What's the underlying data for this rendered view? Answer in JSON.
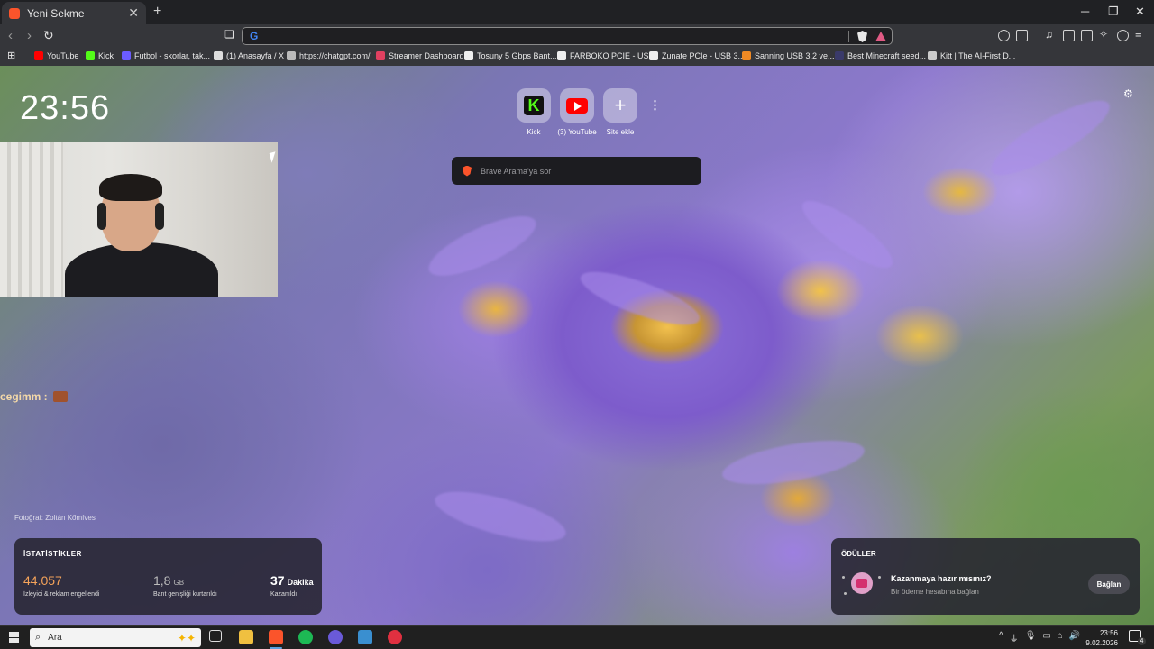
{
  "tab": {
    "title": "Yeni Sekme"
  },
  "omnibox": {
    "value": ""
  },
  "bookmarks": [
    {
      "label": "YouTube",
      "color": "#ff0000"
    },
    {
      "label": "Kick",
      "color": "#53fc18"
    },
    {
      "label": "Futbol - skorlar, tak...",
      "color": "#6b5cff"
    },
    {
      "label": "(1) Anasayfa / X",
      "color": "#dddddd"
    },
    {
      "label": "https://chatgpt.com/",
      "color": "#bbbbbb"
    },
    {
      "label": "Streamer Dashboard",
      "color": "#e04060"
    },
    {
      "label": "Tosuny 5 Gbps Bant...",
      "color": "#eeeeee"
    },
    {
      "label": "FARBOKO PCIE - US...",
      "color": "#eeeeee"
    },
    {
      "label": "Zunate PCIe - USB 3...",
      "color": "#eeeeee"
    },
    {
      "label": "Sanning USB 3.2 ve...",
      "color": "#f08a24"
    },
    {
      "label": "Best Minecraft seed...",
      "color": "#3a3a6a"
    },
    {
      "label": "Kitt | The AI-First D...",
      "color": "#cccccc"
    }
  ],
  "clock": "23:56",
  "chat": {
    "text": "cegimm :"
  },
  "photo_credit": "Fotoğraf: Zoltán Kőmíves",
  "top_sites": [
    {
      "label": "Kick"
    },
    {
      "label": "(3) YouTube"
    },
    {
      "label": "Site ekle"
    }
  ],
  "search": {
    "placeholder": "Brave Arama'ya sor"
  },
  "stats": {
    "title": "İSTATİSTİKLER",
    "blocked_value": "44.057",
    "blocked_desc": "İzleyici & reklam engellendi",
    "bandwidth_value": "1,8",
    "bandwidth_unit": "GB",
    "bandwidth_desc": "Bant genişliği kurtarıldı",
    "time_value": "37",
    "time_unit": "Dakika",
    "time_desc": "Kazanıldı",
    "accent": "#f5a35a"
  },
  "rewards": {
    "title": "ÖDÜLLER",
    "headline": "Kazanmaya hazır mısınız?",
    "subtext": "Bir ödeme hesabına bağlan",
    "button": "Bağlan"
  },
  "taskbar": {
    "search_label": "Ara",
    "time": "23:56",
    "date": "9.02.2026",
    "notifications": "4"
  }
}
